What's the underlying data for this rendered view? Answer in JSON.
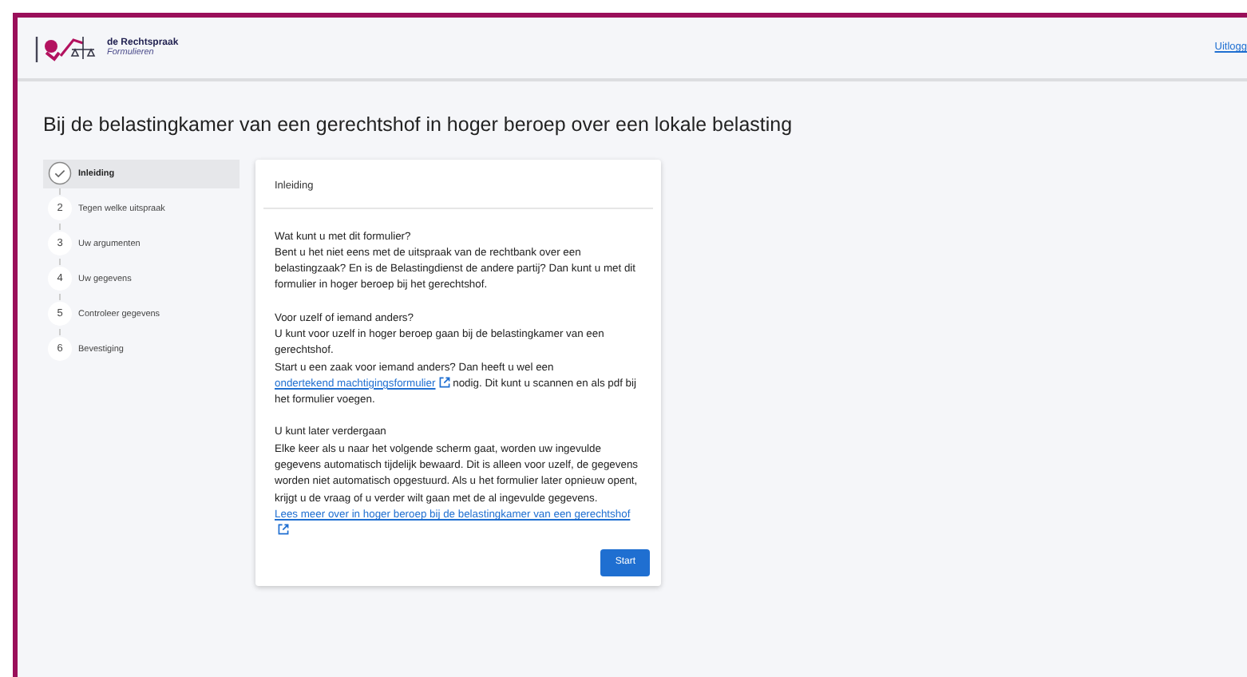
{
  "header": {
    "brand": "de Rechtspraak",
    "subtitle": "Formulieren",
    "logout": "Uitlogg"
  },
  "title": "Bij de belastingkamer van een gerechtshof in hoger beroep over een lokale belasting",
  "steps": [
    {
      "label": "Inleiding",
      "selected": true,
      "completed": true
    },
    {
      "number": "2",
      "label": "Tegen welke uitspraak",
      "selected": false,
      "completed": false
    },
    {
      "number": "3",
      "label": "Uw argumenten",
      "selected": false,
      "completed": false
    },
    {
      "number": "4",
      "label": "Uw gegevens",
      "selected": false,
      "completed": false
    },
    {
      "number": "5",
      "label": "Controleer gegevens",
      "selected": false,
      "completed": false
    },
    {
      "number": "6",
      "label": "Bevestiging",
      "selected": false,
      "completed": false
    }
  ],
  "card": {
    "heading": "Inleiding",
    "sections": [
      {
        "title": "Wat kunt u met dit formulier?",
        "paragraphs": [
          {
            "text": "Bent u het niet eens met de uitspraak van de rechtbank over een belastingzaak? En is de Belastingdienst de andere partij? Dan kunt u met dit formulier in hoger beroep bij het gerechtshof."
          }
        ]
      },
      {
        "title": "Voor uzelf of iemand anders?",
        "paragraphs": [
          {
            "text": "U kunt voor uzelf in hoger beroep gaan bij de belastingkamer van een gerechtshof."
          },
          {
            "text": "Start u een zaak voor iemand anders? Dan heeft u wel een",
            "link": "ondertekend machtigingsformulier",
            "after": "nodig. Dit kunt u scannen en als pdf bij het formulier voegen."
          }
        ]
      },
      {
        "title": "U kunt later verdergaan",
        "paragraphs": [
          {
            "text": "Elke keer als u naar het volgende scherm gaat, worden uw ingevulde gegevens automatisch tijdelijk bewaard. Dit is alleen voor uzelf, de gegevens worden niet automatisch opgestuurd. Als u het formulier later opnieuw opent, krijgt u de vraag of u verder wilt gaan met de al ingevulde gegevens."
          },
          {
            "link": "Lees meer over in hoger beroep bij de belastingkamer van een gerechtshof"
          }
        ]
      }
    ],
    "button": "Start"
  }
}
